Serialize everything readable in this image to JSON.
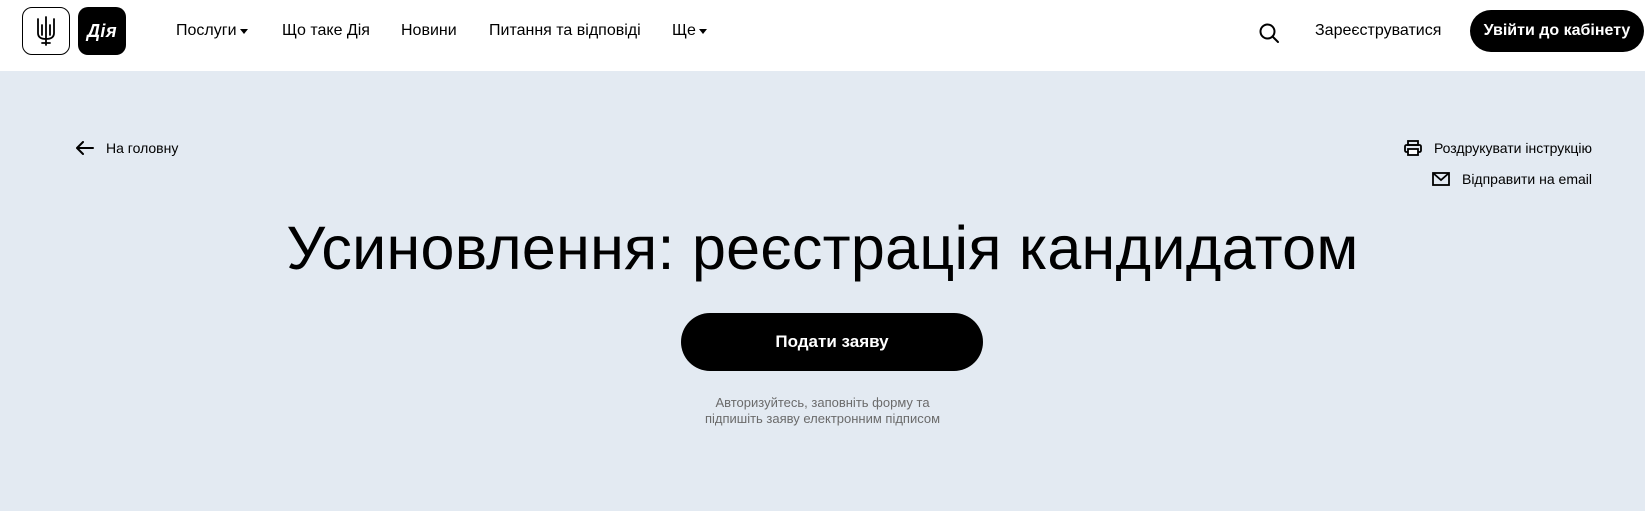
{
  "header": {
    "logo_text": "Дія",
    "nav": [
      {
        "label": "Послуги",
        "dropdown": true
      },
      {
        "label": "Що таке Дія",
        "dropdown": false
      },
      {
        "label": "Новини",
        "dropdown": false
      },
      {
        "label": "Питання та відповіді",
        "dropdown": false
      },
      {
        "label": "Ще",
        "dropdown": true
      }
    ],
    "search_icon": "search-icon",
    "register_label": "Зареєструватися",
    "login_label": "Увійти до кабінету"
  },
  "page": {
    "back_label": "На головну",
    "actions": {
      "print_label": "Роздрукувати інструкцію",
      "email_label": "Відправити на email"
    },
    "title": "Усиновлення: реєстрація кандидатом",
    "submit_label": "Подати заяву",
    "hint_line1": "Авторизуйтесь, заповніть форму та",
    "hint_line2": "підпишіть заяву електронним підписом"
  },
  "colors": {
    "background": "#e3eaf2",
    "header_bg": "#ffffff",
    "primary": "#000000",
    "hint_text": "#6b6b6b"
  }
}
